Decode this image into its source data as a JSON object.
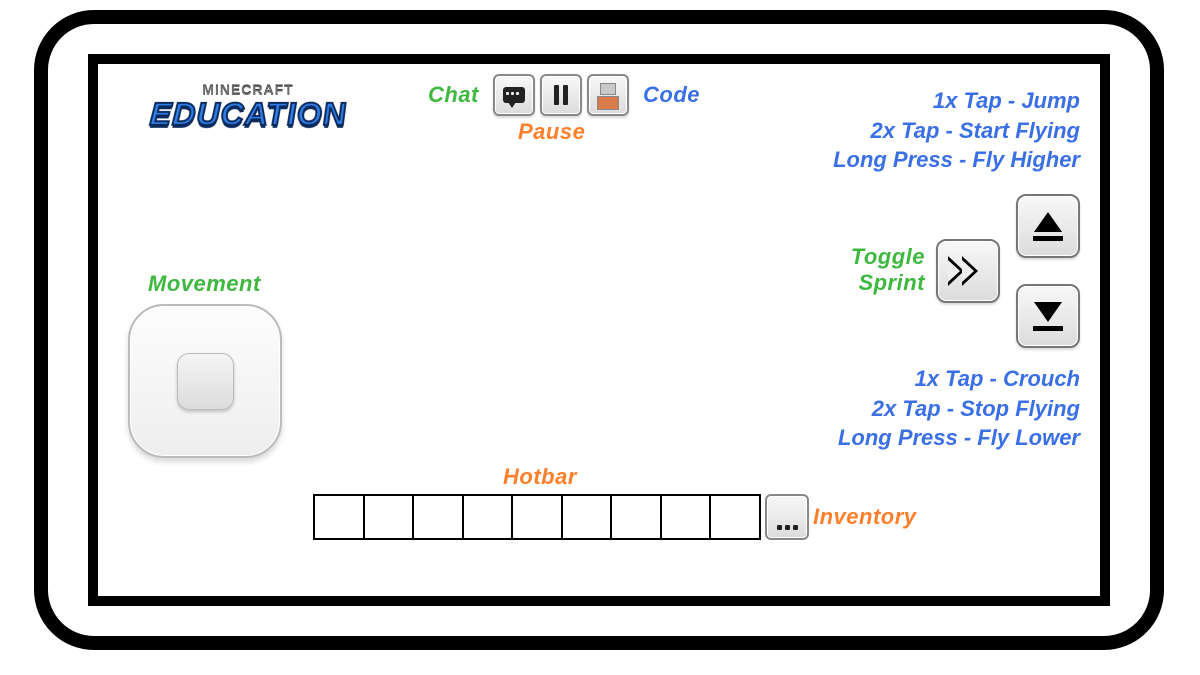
{
  "logo": {
    "top": "MINECRAFT",
    "main": "EDUCATION"
  },
  "labels": {
    "chat": "Chat",
    "pause": "Pause",
    "code": "Code",
    "movement": "Movement",
    "toggle_sprint_l1": "Toggle",
    "toggle_sprint_l2": "Sprint",
    "hotbar": "Hotbar",
    "inventory": "Inventory"
  },
  "instructions": {
    "up": [
      "1x Tap - Jump",
      "2x Tap - Start Flying",
      "Long Press - Fly Higher"
    ],
    "down": [
      "1x Tap - Crouch",
      "2x Tap - Stop Flying",
      "Long Press - Fly Lower"
    ]
  },
  "hotbar": {
    "slot_count": 9
  },
  "colors": {
    "green": "#3fb83f",
    "orange": "#ff7f2a",
    "blue": "#3a6fe6"
  }
}
